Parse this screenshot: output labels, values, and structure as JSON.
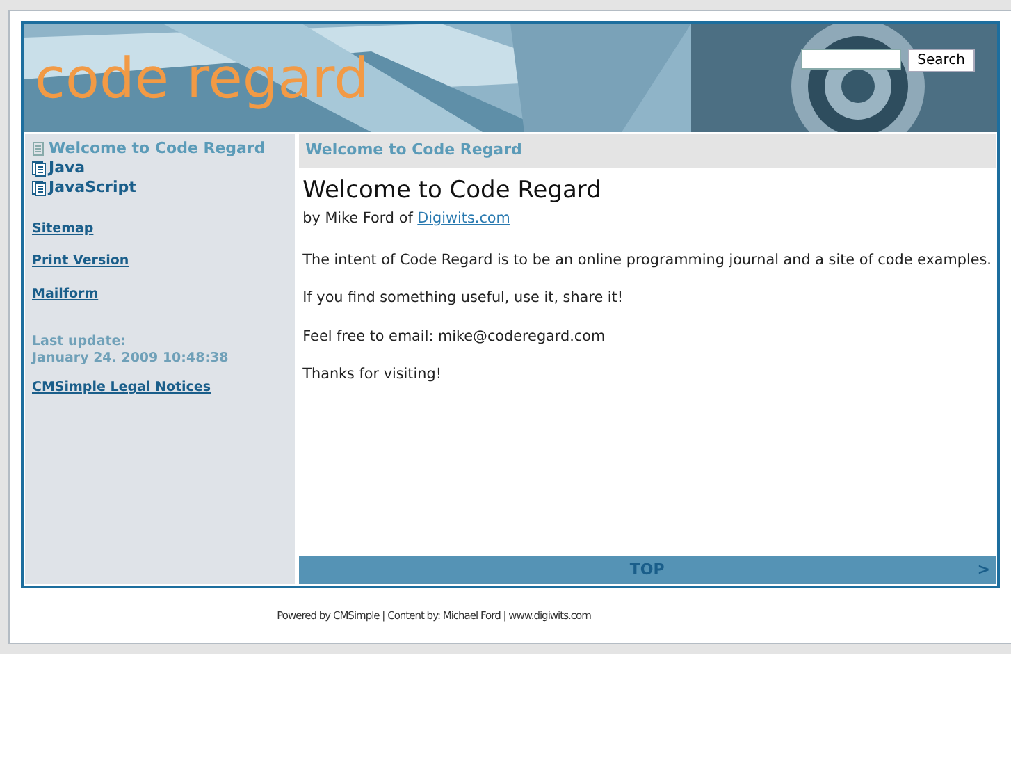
{
  "header": {
    "logo": "code regard",
    "search_button": "Search"
  },
  "menu": [
    {
      "label": "Welcome to Code Regard",
      "selected": true
    },
    {
      "label": "Java",
      "selected": false
    },
    {
      "label": "JavaScript",
      "selected": false
    }
  ],
  "links": [
    "Sitemap",
    "Print Version",
    "Mailform"
  ],
  "last_update": {
    "label": "Last update:",
    "value": "January 24. 2009 10:48:38"
  },
  "legal_link": "CMSimple Legal Notices",
  "content": {
    "breadcrumb": "Welcome to Code Regard",
    "title": "Welcome to Code Regard",
    "byline": "by Mike Ford of ",
    "byline_link": "Digiwits.com",
    "paragraphs": [
      "The intent of Code Regard is to be an online programming journal and a site of code examples.",
      "If you find something useful, use it, share it!",
      "Feel free to email: mike@coderegard.com",
      "Thanks for visiting!"
    ]
  },
  "top_bar": {
    "label": "TOP",
    "next": ">"
  },
  "footer": "Powered by CMSimple | Content by: Michael Ford | www.digiwits.com"
}
